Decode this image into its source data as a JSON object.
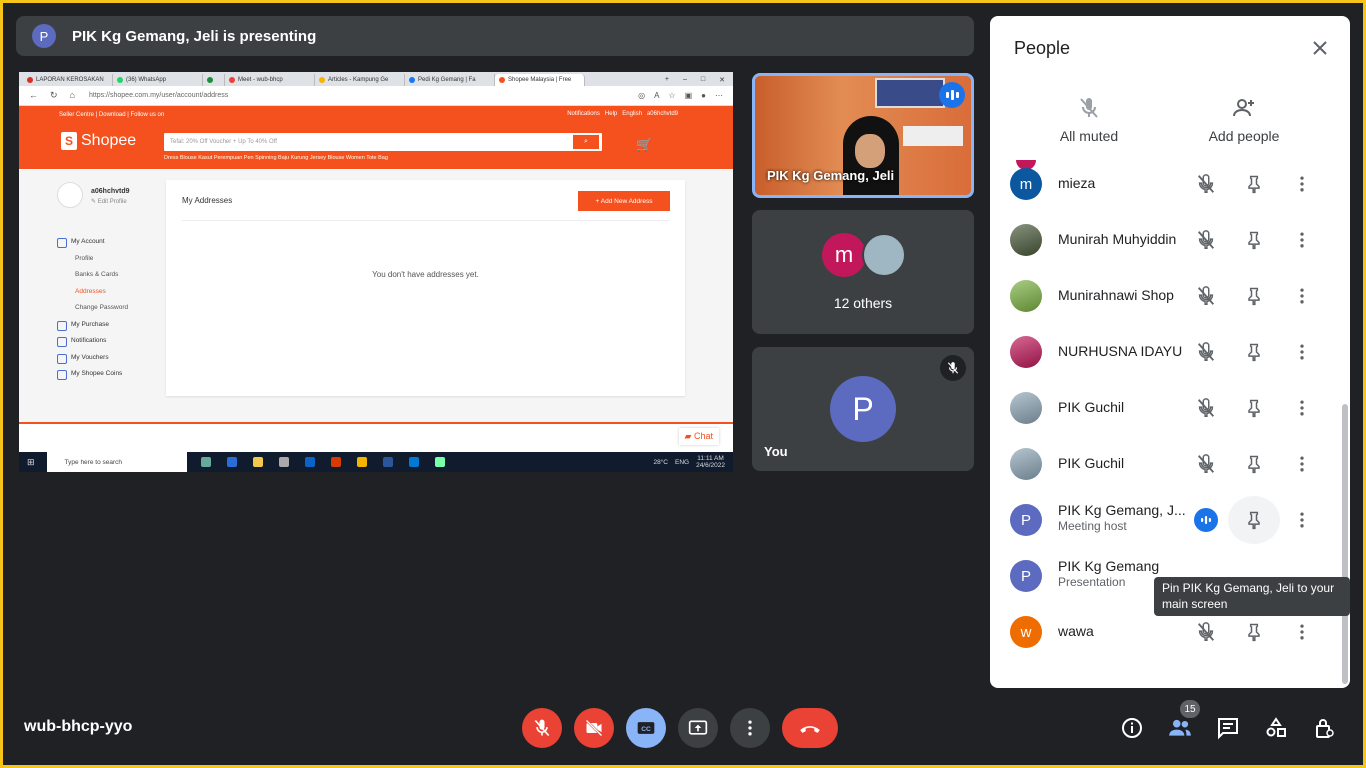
{
  "banner": {
    "avatar_letter": "P",
    "text": "PIK Kg Gemang, Jeli is presenting"
  },
  "presentation": {
    "tabs": [
      "LAPORAN KEROSAKAN",
      "(36) WhatsApp",
      "",
      "Meet - wub-bhcp",
      "Articles - Kampung Ge",
      "Pedi Kg Gemang | Fa",
      "Shopee Malaysia | Free"
    ],
    "url": "https://shopee.com.my/user/account/address",
    "top_links": "Seller Centre | Download | Follow us on",
    "top_right": {
      "notifications": "Notifications",
      "help": "Help",
      "language": "English",
      "user": "a06hchvtd9"
    },
    "logo_text": "Shopee",
    "logo_glyph": "S",
    "search_placeholder": "Tefal: 20% Off Voucher + Up To 40% Off",
    "suggestions": "Dress   Blouse   Kasut Perempuan   Pen Spinning   Baju Kurung   Jersey   Blouse Women   Tote Bag",
    "profile": {
      "username": "a06hchvtd9",
      "edit": "✎ Edit Profile"
    },
    "menu": {
      "my_account": "My Account",
      "profile": "Profile",
      "banks": "Banks & Cards",
      "addresses": "Addresses",
      "change_password": "Change Password",
      "my_purchase": "My Purchase",
      "notifications": "Notifications",
      "vouchers": "My Vouchers",
      "coins": "My Shopee Coins"
    },
    "card_title": "My Addresses",
    "add_button": "+  Add New Address",
    "empty_text": "You don't have addresses yet.",
    "chat_label": "Chat",
    "taskbar": {
      "search": "Type here to search",
      "weather": "28°C",
      "lang": "ENG",
      "time": "11:11 AM",
      "date": "24/6/2022"
    }
  },
  "tiles": {
    "presenter_name": "PIK Kg Gemang, Jeli",
    "others_letter": "m",
    "others_label": "12 others",
    "you_letter": "P",
    "you_label": "You"
  },
  "people": {
    "title": "People",
    "all_muted": "All muted",
    "add_people": "Add people",
    "list": [
      {
        "name": "mieza",
        "letter": "m",
        "color": "#0b57a0",
        "sub": ""
      },
      {
        "name": "Munirah Muhyiddin",
        "letter": "",
        "color": "#4a5a3a",
        "sub": ""
      },
      {
        "name": "Munirahnawi Shop",
        "letter": "",
        "color": "#7cb342",
        "sub": ""
      },
      {
        "name": "NURHUSNA IDAYU",
        "letter": "",
        "color": "#c2185b",
        "sub": ""
      },
      {
        "name": "PIK Guchil",
        "letter": "",
        "color": "#8fa8b8",
        "sub": ""
      },
      {
        "name": "PIK Guchil",
        "letter": "",
        "color": "#8fa8b8",
        "sub": ""
      },
      {
        "name": "PIK Kg Gemang, J...",
        "letter": "P",
        "color": "#5c6bc0",
        "sub": "Meeting host"
      },
      {
        "name": "PIK Kg Gemang",
        "letter": "P",
        "color": "#5c6bc0",
        "sub": "Presentation"
      },
      {
        "name": "wawa",
        "letter": "w",
        "color": "#ef6c00",
        "sub": ""
      }
    ],
    "tooltip": "Pin PIK Kg Gemang, Jeli to your main screen"
  },
  "bottom": {
    "meeting_code": "wub-bhcp-yyo",
    "people_count": "15"
  },
  "colors": {
    "end_call": "#ea4335",
    "captions_active": "#8ab4f8",
    "shopee_orange": "#f4511e",
    "host_avatar": "#5c6bc0"
  }
}
